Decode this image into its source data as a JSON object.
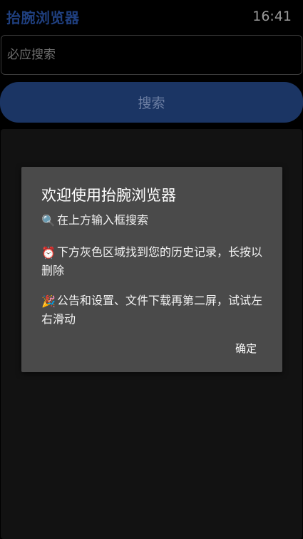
{
  "app": {
    "title": "抬腕浏览器"
  },
  "status": {
    "time": "16:41"
  },
  "search": {
    "placeholder": "必应搜索",
    "value": "",
    "button_label": "搜索"
  },
  "dialog": {
    "title": "欢迎使用抬腕浏览器",
    "items": [
      {
        "icon": "magnifier-icon",
        "glyph": "🔍",
        "text": "在上方输入框搜索"
      },
      {
        "icon": "alarm-clock-icon",
        "glyph": "⏰",
        "text": "下方灰色区域找到您的历史记录，长按以删除"
      },
      {
        "icon": "party-popper-icon",
        "glyph": "🎉",
        "text": "公告和设置、文件下载再第二屏，试试左右滑动"
      }
    ],
    "ok_label": "确定"
  },
  "colors": {
    "background": "#000000",
    "title": "#1f3f7f",
    "button": "#1b3564",
    "history_area": "#121212",
    "dialog": "#4a4a4a"
  }
}
